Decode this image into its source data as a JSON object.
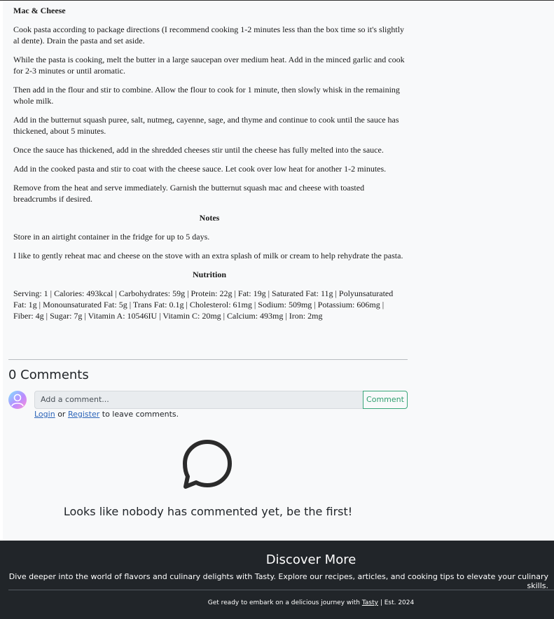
{
  "recipe": {
    "section_title": "Mac & Cheese",
    "steps": [
      "Cook pasta according to package directions (I recommend cooking 1-2 minutes less than the box time so it's slightly al dente). Drain the pasta and set aside.",
      "While the pasta is cooking, melt the butter in a large saucepan over medium heat. Add in the minced garlic and cook for 2-3 minutes or until aromatic.",
      "Then add in the flour and stir to combine. Allow the flour to cook for 1 minute, then slowly whisk in the remaining whole milk.",
      "Add in the butternut squash puree, salt, nutmeg, cayenne, sage, and thyme and continue to cook until the sauce has thickened, about 5 minutes.",
      "Once the sauce has thickened, add in the shredded cheeses stir until the cheese has fully melted into the sauce.",
      "Add in the cooked pasta and stir to coat with the cheese sauce. Let cook over low heat for another 1-2 minutes.",
      "Remove from the heat and serve immediately. Garnish the butternut squash mac and cheese with toasted breadcrumbs if desired."
    ],
    "notes_title": "Notes",
    "notes": [
      "Store in an airtight container in the fridge for up to 5 days.",
      "I like to gently reheat mac and cheese on the stove with an extra splash of milk or cream to help rehydrate the pasta."
    ],
    "nutrition_title": "Nutrition",
    "nutrition_text": "Serving: 1 | Calories: 493kcal | Carbohydrates: 59g | Protein: 22g | Fat: 19g | Saturated Fat: 11g | Polyunsaturated Fat: 1g | Monounsaturated Fat: 5g | Trans Fat: 0.1g | Cholesterol: 61mg | Sodium: 509mg | Potassium: 606mg | Fiber: 4g | Sugar: 7g | Vitamin A: 10546IU | Vitamin C: 20mg | Calcium: 493mg | Iron: 2mg"
  },
  "comments": {
    "title": "0 Comments",
    "placeholder": "Add a comment...",
    "submit_label": "Comment",
    "login_label": "Login",
    "or_text": "or",
    "register_label": "Register",
    "suffix_text": "to leave comments.",
    "empty_message": "Looks like nobody has commented yet, be the first!",
    "avatar_icon": "user-avatar-icon",
    "empty_icon": "chat-bubble-icon"
  },
  "footer": {
    "title": "Discover More",
    "tagline": "Dive deeper into the world of flavors and culinary delights with Tasty. Explore our recipes, articles, and cooking tips to elevate your culinary skills.",
    "copy_prefix": "Get ready to embark on a delicious journey with",
    "brand_link": "Tasty",
    "copy_suffix": "| Est. 2024"
  },
  "colors": {
    "footer_bg": "#212529",
    "accent_green": "#2e9e6e",
    "link_blue": "#2a63b8"
  }
}
